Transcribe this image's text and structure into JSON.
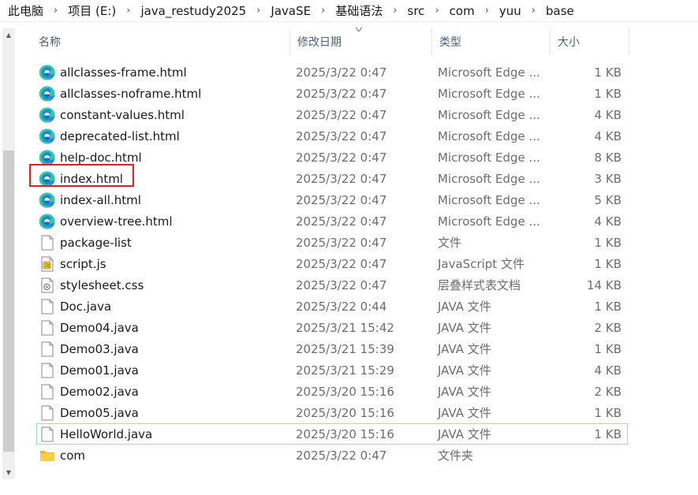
{
  "breadcrumb": [
    "此电脑",
    "项目 (E:)",
    "java_restudy2025",
    "JavaSE",
    "基础语法",
    "src",
    "com",
    "yuu",
    "base"
  ],
  "columns": {
    "name": "名称",
    "date": "修改日期",
    "type": "类型",
    "size": "大小"
  },
  "files": [
    {
      "icon": "edge-icon",
      "name": "allclasses-frame.html",
      "date": "2025/3/22 0:47",
      "type": "Microsoft Edge ...",
      "size": "1 KB"
    },
    {
      "icon": "edge-icon",
      "name": "allclasses-noframe.html",
      "date": "2025/3/22 0:47",
      "type": "Microsoft Edge ...",
      "size": "1 KB"
    },
    {
      "icon": "edge-icon",
      "name": "constant-values.html",
      "date": "2025/3/22 0:47",
      "type": "Microsoft Edge ...",
      "size": "4 KB"
    },
    {
      "icon": "edge-icon",
      "name": "deprecated-list.html",
      "date": "2025/3/22 0:47",
      "type": "Microsoft Edge ...",
      "size": "4 KB"
    },
    {
      "icon": "edge-icon",
      "name": "help-doc.html",
      "date": "2025/3/22 0:47",
      "type": "Microsoft Edge ...",
      "size": "8 KB"
    },
    {
      "icon": "edge-icon",
      "name": "index.html",
      "date": "2025/3/22 0:47",
      "type": "Microsoft Edge ...",
      "size": "3 KB"
    },
    {
      "icon": "edge-icon",
      "name": "index-all.html",
      "date": "2025/3/22 0:47",
      "type": "Microsoft Edge ...",
      "size": "5 KB"
    },
    {
      "icon": "edge-icon",
      "name": "overview-tree.html",
      "date": "2025/3/22 0:47",
      "type": "Microsoft Edge ...",
      "size": "4 KB"
    },
    {
      "icon": "file-icon",
      "name": "package-list",
      "date": "2025/3/22 0:47",
      "type": "文件",
      "size": "1 KB"
    },
    {
      "icon": "script-file-icon",
      "name": "script.js",
      "date": "2025/3/22 0:47",
      "type": "JavaScript 文件",
      "size": "1 KB"
    },
    {
      "icon": "css-file-icon",
      "name": "stylesheet.css",
      "date": "2025/3/22 0:47",
      "type": "层叠样式表文档",
      "size": "14 KB"
    },
    {
      "icon": "file-icon",
      "name": "Doc.java",
      "date": "2025/3/22 0:44",
      "type": "JAVA 文件",
      "size": "1 KB"
    },
    {
      "icon": "file-icon",
      "name": "Demo04.java",
      "date": "2025/3/21 15:42",
      "type": "JAVA 文件",
      "size": "2 KB"
    },
    {
      "icon": "file-icon",
      "name": "Demo03.java",
      "date": "2025/3/21 15:39",
      "type": "JAVA 文件",
      "size": "1 KB"
    },
    {
      "icon": "file-icon",
      "name": "Demo01.java",
      "date": "2025/3/21 15:29",
      "type": "JAVA 文件",
      "size": "4 KB"
    },
    {
      "icon": "file-icon",
      "name": "Demo02.java",
      "date": "2025/3/20 15:16",
      "type": "JAVA 文件",
      "size": "2 KB"
    },
    {
      "icon": "file-icon",
      "name": "Demo05.java",
      "date": "2025/3/20 15:16",
      "type": "JAVA 文件",
      "size": "1 KB"
    },
    {
      "icon": "file-icon",
      "name": "HelloWorld.java",
      "date": "2025/3/20 15:16",
      "type": "JAVA 文件",
      "size": "1 KB",
      "focused": true
    },
    {
      "icon": "folder-icon",
      "name": "com",
      "date": "2025/3/22 0:47",
      "type": "文件夹",
      "size": ""
    }
  ],
  "colors": {
    "highlight": "#e02020",
    "focus": "#99d1ff",
    "header_text": "#4c607a",
    "secondary_text": "#6d6d6d"
  }
}
